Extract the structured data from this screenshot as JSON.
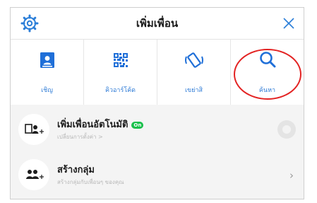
{
  "header": {
    "title": "เพิ่มเพื่อน",
    "settings_icon": "gear-icon",
    "close_icon": "close-icon"
  },
  "tools": [
    {
      "label": "เชิญ",
      "icon": "contact-book-icon"
    },
    {
      "label": "คิวอาร์โค้ด",
      "icon": "qr-code-icon"
    },
    {
      "label": "เขย่าสิ",
      "icon": "shake-phone-icon"
    },
    {
      "label": "ค้นหา",
      "icon": "search-icon"
    }
  ],
  "list": {
    "auto_add": {
      "title": "เพิ่มเพื่อนอัตโนมัติ",
      "badge": "On",
      "subtitle": "เปลี่ยนการตั้งค่า >"
    },
    "create_group": {
      "title": "สร้างกลุ่ม",
      "subtitle": "สร้างกลุ่มกับเพื่อนๆ ของคุณ",
      "chevron": "›"
    }
  },
  "colors": {
    "accent_blue": "#1f6fd8",
    "badge_green": "#19c04b",
    "highlight_red": "#e32323"
  }
}
